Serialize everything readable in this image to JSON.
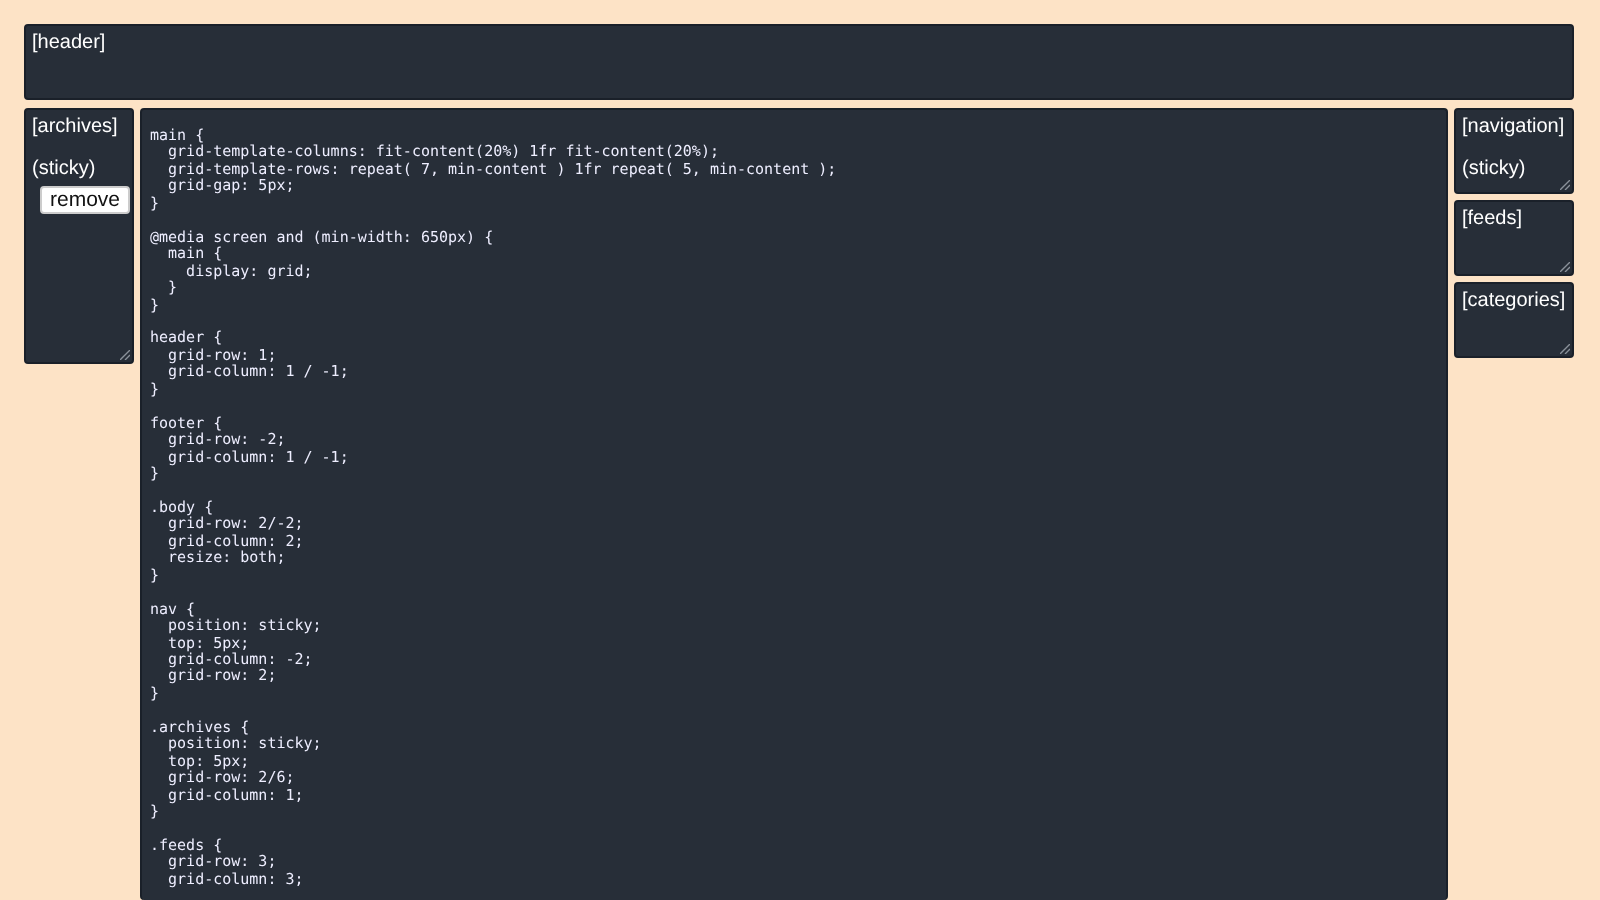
{
  "header": {
    "label": "[header]"
  },
  "archives": {
    "label": "[archives]",
    "note": "(sticky)",
    "button": "remove"
  },
  "code_blocks": [
    [
      "main {",
      "  grid-template-columns: fit-content(20%) 1fr fit-content(20%);",
      "  grid-template-rows: repeat( 7, min-content ) 1fr repeat( 5, min-content );",
      "  grid-gap: 5px;",
      "}"
    ],
    [
      "@media screen and (min-width: 650px) {",
      "  main {",
      "    display: grid;",
      "  }",
      "}"
    ],
    [
      "header {",
      "  grid-row: 1;",
      "  grid-column: 1 / -1;",
      "}"
    ],
    [
      "footer {",
      "  grid-row: -2;",
      "  grid-column: 1 / -1;",
      "}"
    ],
    [
      ".body {",
      "  grid-row: 2/-2;",
      "  grid-column: 2;",
      "  resize: both;",
      "}"
    ],
    [
      "nav {",
      "  position: sticky;",
      "  top: 5px;",
      "  grid-column: -2;",
      "  grid-row: 2;",
      "}"
    ],
    [
      ".archives {",
      "  position: sticky;",
      "  top: 5px;",
      "  grid-row: 2/6;",
      "  grid-column: 1;",
      "}"
    ],
    [
      ".feeds {",
      "  grid-row: 3;",
      "  grid-column: 3;"
    ]
  ],
  "side_panels": [
    {
      "label": "[navigation]",
      "note": "(sticky)"
    },
    {
      "label": "[feeds]"
    },
    {
      "label": "[categories]"
    }
  ]
}
